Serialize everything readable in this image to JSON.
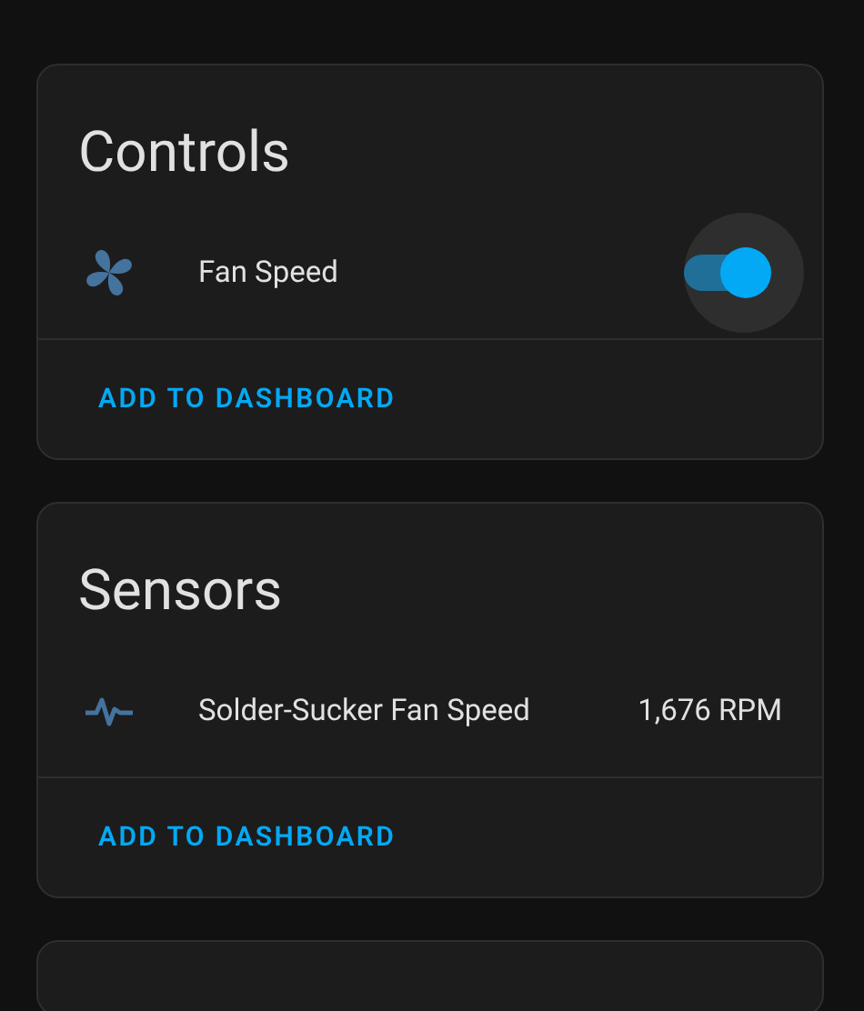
{
  "cards": [
    {
      "title": "Controls",
      "entities": [
        {
          "kind": "toggle",
          "name": "Fan Speed",
          "on": true
        }
      ],
      "action": "ADD TO DASHBOARD"
    },
    {
      "title": "Sensors",
      "entities": [
        {
          "kind": "sensor",
          "name": "Solder-Sucker Fan Speed",
          "state": "1,676 RPM"
        }
      ],
      "action": "ADD TO DASHBOARD"
    }
  ]
}
